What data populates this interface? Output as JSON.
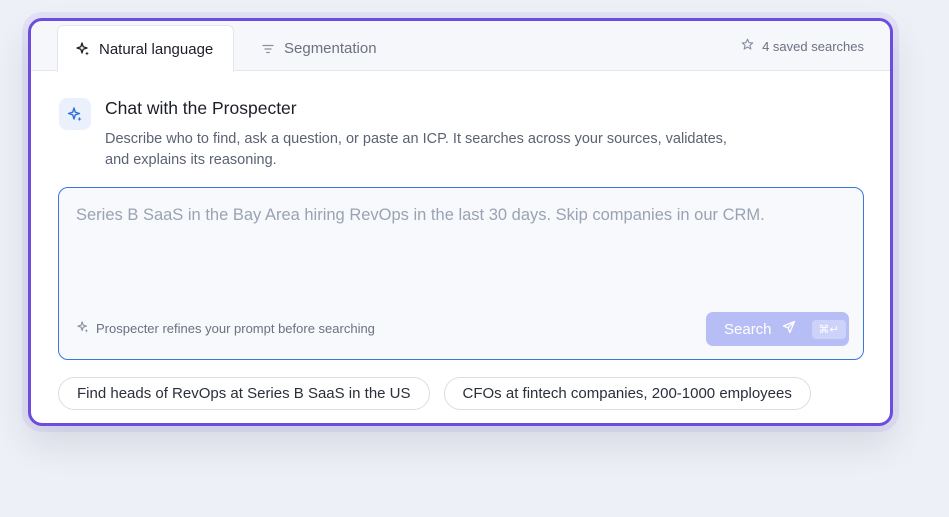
{
  "tabs": [
    {
      "label": "Natural language",
      "icon": "sparkle-icon",
      "active": true
    },
    {
      "label": "Segmentation",
      "icon": "filter-icon",
      "active": false
    }
  ],
  "saved": {
    "label": "4 saved searches",
    "icon": "star-icon"
  },
  "header": {
    "title": "Chat with the Prospecter",
    "description": "Describe who to find, ask a question, or paste an ICP. It searches across your sources, validates, and explains its reasoning.",
    "icon": "sparkle-icon"
  },
  "prompt": {
    "value": "",
    "placeholder": "Series B SaaS in the Bay Area hiring RevOps in the last 30 days. Skip companies in our CRM.",
    "hint": "Prospecter refines your prompt before searching",
    "hint_icon": "sparkle-icon"
  },
  "search_button": {
    "label": "Search",
    "icon": "send-icon",
    "shortcut": "⌘↵"
  },
  "suggestions": [
    "Find heads of RevOps at Series B SaaS in the US",
    "CFOs at fintech companies, 200-1000 employees"
  ],
  "colors": {
    "accent": "#6d4ce0",
    "focus": "#3a78d8",
    "button_disabled": "#b7bef6",
    "icon_bg": "#eaf1fd"
  }
}
